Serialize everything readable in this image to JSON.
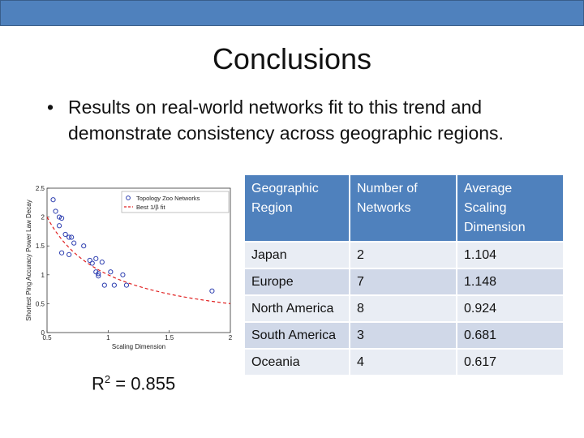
{
  "slide": {
    "title": "Conclusions",
    "bullet": "Results on real-world networks fit to this trend and demonstrate consistency across geographic regions.",
    "bullet_marker": "•",
    "accent_color": "#4f81bd"
  },
  "chart_data": {
    "type": "scatter",
    "title": "",
    "xlabel": "Scaling Dimension",
    "ylabel": "Shortest Ping Accuracy Power Law Decay",
    "xlim": [
      0.5,
      2
    ],
    "ylim": [
      0,
      2.5
    ],
    "x_ticks": [
      "0.5",
      "1",
      "1.5",
      "2"
    ],
    "y_ticks": [
      "0",
      "0.5",
      "1",
      "1.5",
      "2",
      "2.5"
    ],
    "legend": "top-right",
    "series": [
      {
        "name": "Topology Zoo Networks",
        "marker": "circle",
        "color": "#2e3fb0",
        "points": [
          [
            0.55,
            2.3
          ],
          [
            0.57,
            2.1
          ],
          [
            0.6,
            2.0
          ],
          [
            0.62,
            1.98
          ],
          [
            0.6,
            1.85
          ],
          [
            0.65,
            1.7
          ],
          [
            0.68,
            1.65
          ],
          [
            0.7,
            1.65
          ],
          [
            0.72,
            1.55
          ],
          [
            0.62,
            1.38
          ],
          [
            0.68,
            1.35
          ],
          [
            0.8,
            1.5
          ],
          [
            0.85,
            1.25
          ],
          [
            0.87,
            1.2
          ],
          [
            0.9,
            1.28
          ],
          [
            0.95,
            1.22
          ],
          [
            0.92,
            1.02
          ],
          [
            0.9,
            1.05
          ],
          [
            0.92,
            0.98
          ],
          [
            1.02,
            1.05
          ],
          [
            0.97,
            0.82
          ],
          [
            1.05,
            0.82
          ],
          [
            1.12,
            1.0
          ],
          [
            1.15,
            0.82
          ],
          [
            1.85,
            0.72
          ]
        ]
      },
      {
        "name": "Best 1/β fit",
        "style": "dashed",
        "color": "#e02020",
        "formula": "1/x"
      }
    ],
    "annotation": "R2 = 0.855"
  },
  "table": {
    "header_color": "#4f81bd",
    "headers": [
      "Geographic Region",
      "Number of Networks",
      "Average Scaling Dimension"
    ],
    "rows": [
      [
        "Japan",
        "2",
        "1.104"
      ],
      [
        "Europe",
        "7",
        "1.148"
      ],
      [
        "North America",
        "8",
        "0.924"
      ],
      [
        "South America",
        "3",
        "0.681"
      ],
      [
        "Oceania",
        "4",
        "0.617"
      ]
    ]
  },
  "r2": {
    "prefix": "R",
    "superscript": "2",
    "suffix": " = 0.855"
  }
}
